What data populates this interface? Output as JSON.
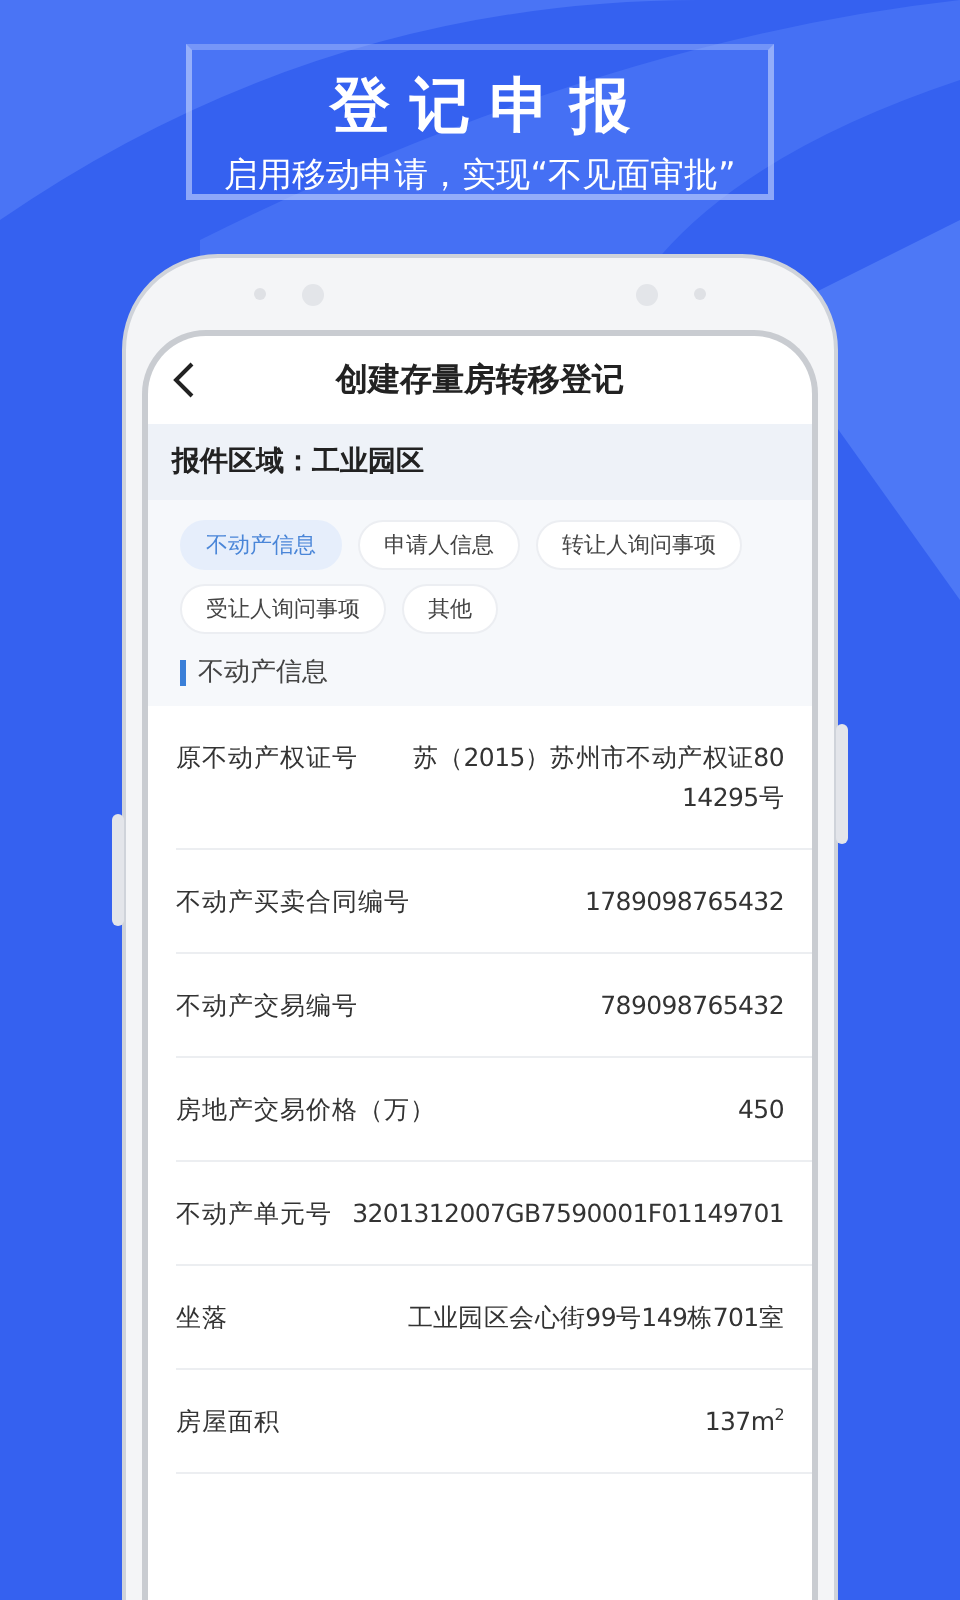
{
  "banner": {
    "title": "登记申报",
    "subtitle": "启用移动申请，实现“不见面审批”"
  },
  "screen": {
    "title": "创建存量房转移登记",
    "region": "报件区域：工业园区",
    "tabs": [
      {
        "label": "不动产信息",
        "selected": true
      },
      {
        "label": "申请人信息",
        "selected": false
      },
      {
        "label": "转让人询问事项",
        "selected": false
      },
      {
        "label": "受让人询问事项",
        "selected": false
      },
      {
        "label": "其他",
        "selected": false
      }
    ],
    "section": "不动产信息",
    "fields": [
      {
        "label": "原不动产权证号",
        "value": "苏（2015）苏州市不动产权证8014295号"
      },
      {
        "label": "不动产买卖合同编号",
        "value": "1789098765432"
      },
      {
        "label": "不动产交易编号",
        "value": "789098765432"
      },
      {
        "label": "房地产交易价格（万）",
        "value": "450"
      },
      {
        "label": "不动产单元号",
        "value": "3201312007GB7590001F01149701"
      },
      {
        "label": "坐落",
        "value": "工业园区会心街99号149栋701室"
      },
      {
        "label": "房屋面积",
        "value": "137m$^{2}$"
      }
    ]
  }
}
